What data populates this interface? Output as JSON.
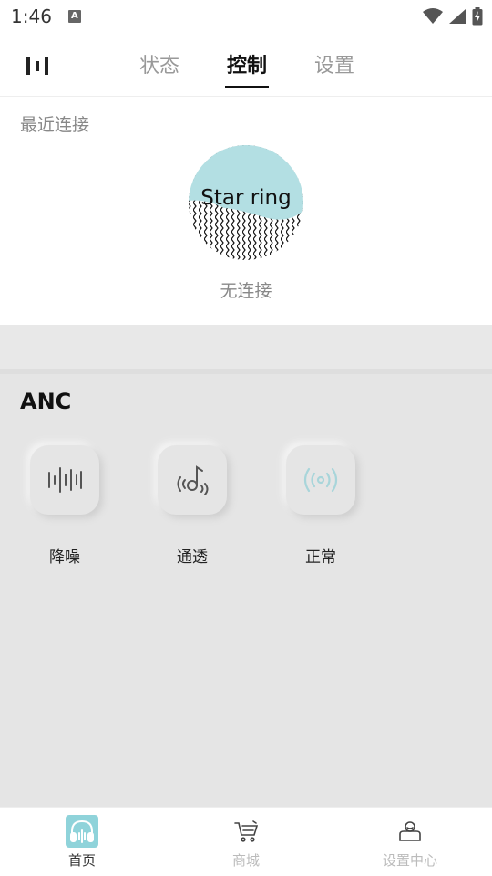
{
  "status_bar": {
    "time": "1:46",
    "app_icon_letter": "A",
    "icons": [
      "wifi-icon",
      "cellular-signal-icon",
      "battery-charging-icon"
    ]
  },
  "top_tabs": [
    {
      "label": "状态",
      "active": false
    },
    {
      "label": "控制",
      "active": true
    },
    {
      "label": "设置",
      "active": false
    }
  ],
  "recent": {
    "title": "最近连接",
    "device_name": "Star ring",
    "connection_status": "无连接"
  },
  "anc": {
    "title": "ANC",
    "modes": [
      {
        "label": "降噪",
        "icon": "noise-cancel-waveform-icon",
        "active": false
      },
      {
        "label": "通透",
        "icon": "transparency-note-icon",
        "active": false
      },
      {
        "label": "正常",
        "icon": "normal-signal-icon",
        "active": true
      }
    ]
  },
  "bottom_nav": [
    {
      "label": "首页",
      "icon": "headphones-icon",
      "active": true
    },
    {
      "label": "商城",
      "icon": "cart-icon",
      "active": false
    },
    {
      "label": "设置中心",
      "icon": "user-settings-icon",
      "active": false
    }
  ],
  "colors": {
    "accent": "#8fd3da",
    "ring_fill": "#b3dfe3",
    "anc_background": "#e5e5e5",
    "active_icon": "#a8d5da",
    "inactive_text": "#bbbbbb"
  }
}
